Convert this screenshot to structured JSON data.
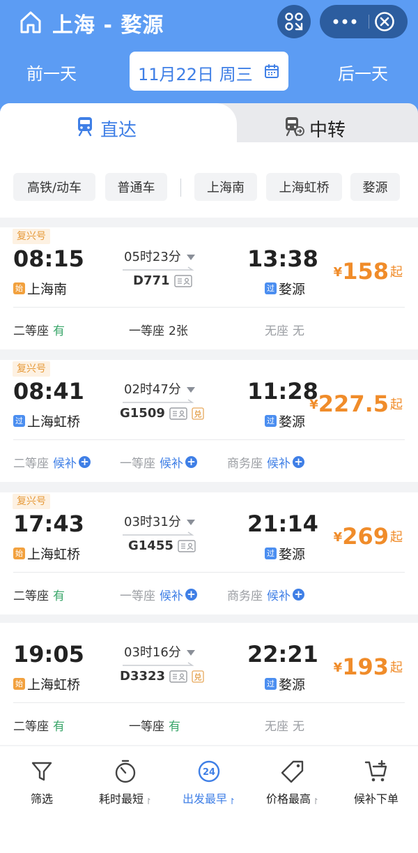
{
  "header": {
    "title": "上海 - 婺源",
    "prev_day": "前一天",
    "next_day": "后一天",
    "date": "11月22日 周三"
  },
  "tabs": [
    {
      "label": "直达",
      "active": true
    },
    {
      "label": "中转",
      "active": false
    }
  ],
  "filters": [
    "高铁/动车",
    "普通车",
    "上海南",
    "上海虹桥",
    "婺源"
  ],
  "trains": [
    {
      "badge": "复兴号",
      "dep_time": "08:15",
      "dep_tag": "始",
      "dep_station": "上海南",
      "duration": "05时23分",
      "train_no": "D771",
      "exchange": false,
      "arr_time": "13:38",
      "arr_tag": "过",
      "arr_station": "婺源",
      "price_symbol": "¥",
      "price": "158",
      "price_suffix": "起",
      "seats": [
        {
          "name": "二等座",
          "value": "有",
          "style": "green",
          "muted": false,
          "waitlist": false
        },
        {
          "name": "一等座",
          "value": "2张",
          "style": "dark",
          "muted": false,
          "waitlist": false
        },
        {
          "name": "无座",
          "value": "无",
          "style": "gray",
          "muted": true,
          "waitlist": false
        }
      ]
    },
    {
      "badge": "复兴号",
      "dep_time": "08:41",
      "dep_tag": "过",
      "dep_station": "上海虹桥",
      "duration": "02时47分",
      "train_no": "G1509",
      "exchange": true,
      "arr_time": "11:28",
      "arr_tag": "过",
      "arr_station": "婺源",
      "price_symbol": "¥",
      "price": "227.5",
      "price_suffix": "起",
      "seats": [
        {
          "name": "二等座",
          "value": "候补",
          "style": "blue",
          "muted": true,
          "waitlist": true
        },
        {
          "name": "一等座",
          "value": "候补",
          "style": "blue",
          "muted": true,
          "waitlist": true
        },
        {
          "name": "商务座",
          "value": "候补",
          "style": "blue",
          "muted": true,
          "waitlist": true
        }
      ]
    },
    {
      "badge": "复兴号",
      "dep_time": "17:43",
      "dep_tag": "始",
      "dep_station": "上海虹桥",
      "duration": "03时31分",
      "train_no": "G1455",
      "exchange": false,
      "arr_time": "21:14",
      "arr_tag": "过",
      "arr_station": "婺源",
      "price_symbol": "¥",
      "price": "269",
      "price_suffix": "起",
      "seats": [
        {
          "name": "二等座",
          "value": "有",
          "style": "green",
          "muted": false,
          "waitlist": false
        },
        {
          "name": "一等座",
          "value": "候补",
          "style": "blue",
          "muted": true,
          "waitlist": true
        },
        {
          "name": "商务座",
          "value": "候补",
          "style": "blue",
          "muted": true,
          "waitlist": true
        }
      ]
    },
    {
      "badge": "",
      "dep_time": "19:05",
      "dep_tag": "始",
      "dep_station": "上海虹桥",
      "duration": "03时16分",
      "train_no": "D3323",
      "exchange": true,
      "arr_time": "22:21",
      "arr_tag": "过",
      "arr_station": "婺源",
      "price_symbol": "¥",
      "price": "193",
      "price_suffix": "起",
      "seats": [
        {
          "name": "二等座",
          "value": "有",
          "style": "green",
          "muted": false,
          "waitlist": false
        },
        {
          "name": "一等座",
          "value": "有",
          "style": "green",
          "muted": false,
          "waitlist": false
        },
        {
          "name": "无座",
          "value": "无",
          "style": "gray",
          "muted": true,
          "waitlist": false
        }
      ]
    }
  ],
  "bottom_bar": [
    {
      "label": "筛选",
      "icon": "filter-icon",
      "active": false,
      "sortable": false
    },
    {
      "label": "耗时最短",
      "icon": "stopwatch-icon",
      "active": false,
      "sortable": true
    },
    {
      "label": "出发最早",
      "icon": "clock-24-icon",
      "active": true,
      "sortable": true
    },
    {
      "label": "价格最高",
      "icon": "price-tag-icon",
      "active": false,
      "sortable": true
    },
    {
      "label": "候补下单",
      "icon": "cart-add-icon",
      "active": false,
      "sortable": false
    }
  ],
  "icon_text": {
    "clock24": "24",
    "exchange": "兑"
  },
  "colors": {
    "header_bg": "#5c9cf3",
    "accent_blue": "#3f7fe6",
    "price_orange": "#f08c2a",
    "available_green": "#3aa66a",
    "badge_bg": "#fdf1e2",
    "badge_text": "#e69a3a"
  }
}
